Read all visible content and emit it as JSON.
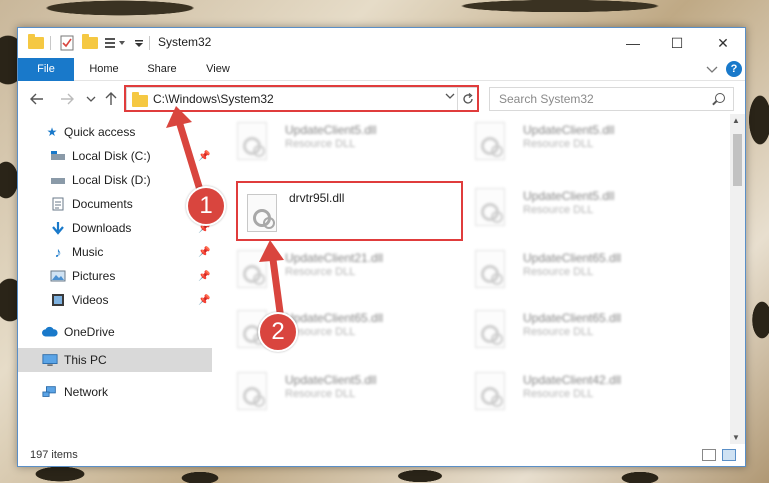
{
  "window": {
    "title": "System32",
    "controls": {
      "minimize": "—",
      "maximize": "☐",
      "close": "✕"
    }
  },
  "ribbon": {
    "tabs": [
      {
        "label": "File",
        "active": true
      },
      {
        "label": "Home"
      },
      {
        "label": "Share"
      },
      {
        "label": "View"
      }
    ],
    "collapse_icon": "chevron-down-icon",
    "help_icon": "help-icon",
    "help_label": "?"
  },
  "address": {
    "path": "C:\\Windows\\System32",
    "search_placeholder": "Search System32"
  },
  "sidebar": {
    "items": [
      {
        "label": "Quick access",
        "icon": "star-icon",
        "pinned": false,
        "level": 0
      },
      {
        "label": "Local Disk (C:)",
        "icon": "disk-icon",
        "pinned": true,
        "level": 1
      },
      {
        "label": "Local Disk (D:)",
        "icon": "disk-icon",
        "pinned": false,
        "level": 1
      },
      {
        "label": "Documents",
        "icon": "documents-icon",
        "pinned": true,
        "level": 1
      },
      {
        "label": "Downloads",
        "icon": "download-icon",
        "pinned": true,
        "level": 1
      },
      {
        "label": "Music",
        "icon": "music-icon",
        "pinned": true,
        "level": 1
      },
      {
        "label": "Pictures",
        "icon": "pictures-icon",
        "pinned": true,
        "level": 1
      },
      {
        "label": "Videos",
        "icon": "videos-icon",
        "pinned": true,
        "level": 1
      },
      {
        "label": "OneDrive",
        "icon": "cloud-icon",
        "pinned": false,
        "level": 0
      },
      {
        "label": "This PC",
        "icon": "pc-icon",
        "pinned": false,
        "level": 0,
        "selected": true
      },
      {
        "label": "Network",
        "icon": "network-icon",
        "pinned": false,
        "level": 0
      }
    ]
  },
  "files": [
    {
      "name": "UpdateClient5.dll",
      "type": "Resource DLL",
      "blurred": true
    },
    {
      "name": "UpdateClient5.dll",
      "type": "Resource DLL",
      "blurred": true
    },
    {
      "name": "drvtr95l.dll",
      "type": "",
      "blurred": false,
      "highlighted": true
    },
    {
      "name": "UpdateClient5.dll",
      "type": "Resource DLL",
      "blurred": true
    },
    {
      "name": "UpdateClient21.dll",
      "type": "Resource DLL",
      "blurred": true
    },
    {
      "name": "UpdateClient65.dll",
      "type": "Resource DLL",
      "blurred": true
    },
    {
      "name": "UpdateClient65.dll",
      "type": "Resource DLL",
      "blurred": true
    },
    {
      "name": "UpdateClient65.dll",
      "type": "Resource DLL",
      "blurred": true
    },
    {
      "name": "UpdateClient5.dll",
      "type": "Resource DLL",
      "blurred": true
    },
    {
      "name": "UpdateClient42.dll",
      "type": "Resource DLL",
      "blurred": true
    }
  ],
  "status": {
    "item_count": "197 items"
  },
  "annotations": {
    "badge1": "1",
    "badge2": "2",
    "color": "#d9453e"
  }
}
